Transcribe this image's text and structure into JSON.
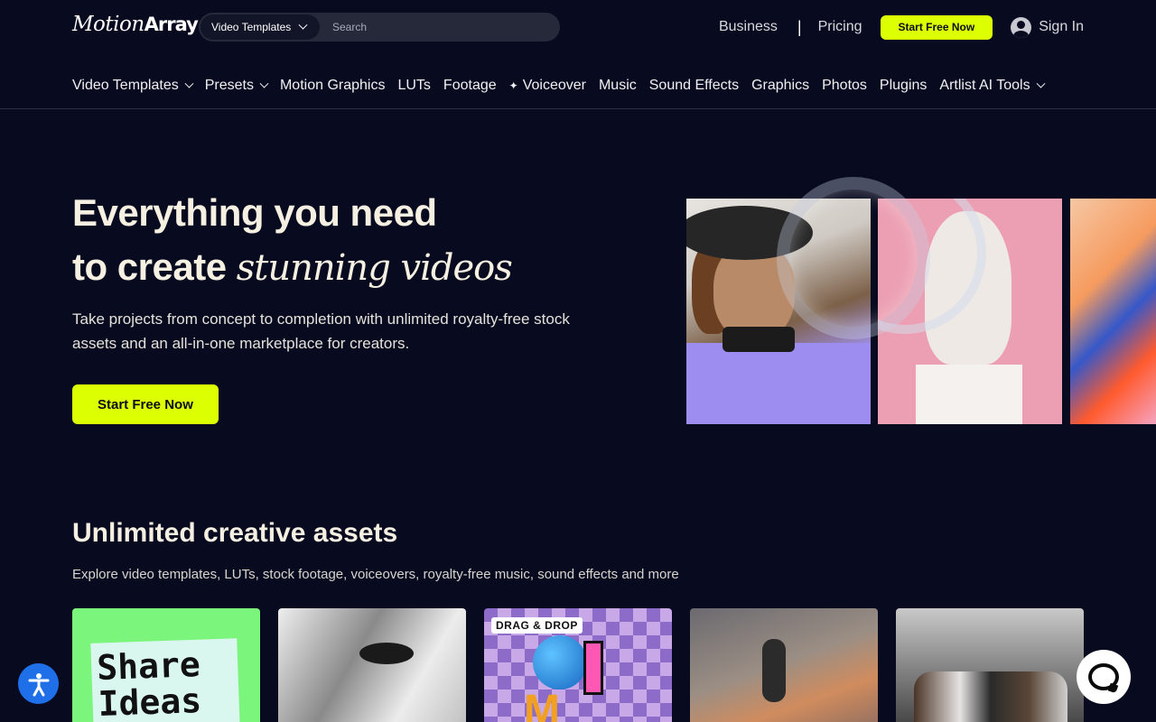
{
  "header": {
    "logo_main": "Motion",
    "logo_bold": "Array",
    "search_category": "Video Templates",
    "search_placeholder": "Search",
    "links": {
      "business": "Business",
      "separator": "|",
      "pricing": "Pricing"
    },
    "cta": "Start Free Now",
    "signin": "Sign In"
  },
  "nav": {
    "items": [
      {
        "label": "Video Templates",
        "dropdown": true
      },
      {
        "label": "Presets",
        "dropdown": true
      },
      {
        "label": "Motion Graphics"
      },
      {
        "label": "LUTs"
      },
      {
        "label": "Footage"
      },
      {
        "label": "Voiceover",
        "icon": "sparkle-icon"
      },
      {
        "label": "Music"
      },
      {
        "label": "Sound Effects"
      },
      {
        "label": "Graphics"
      },
      {
        "label": "Photos"
      },
      {
        "label": "Plugins"
      },
      {
        "label": "Artlist AI Tools",
        "dropdown": true
      }
    ]
  },
  "hero": {
    "title_line1": "Everything you need",
    "title_line2_a": "to create ",
    "title_line2_b": "stunning videos",
    "subtitle": "Take projects from concept to completion with unlimited royalty-free stock assets and an all-in-one marketplace for creators.",
    "cta": "Start Free Now"
  },
  "assets": {
    "title": "Unlimited creative assets",
    "subtitle": "Explore video templates, LUTs, stock footage, voiceovers, royalty-free music, sound effects and more",
    "card1_text_line1": "Share",
    "card1_text_line2": "Ideas",
    "card3_badge": "DRAG & DROP",
    "card3_letter": "M"
  },
  "colors": {
    "background": "#080a1f",
    "accent": "#dcff02",
    "text": "#f5f0e1"
  }
}
